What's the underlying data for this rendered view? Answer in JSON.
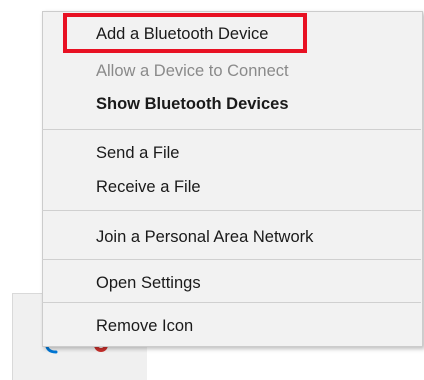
{
  "context_menu": {
    "items": [
      {
        "label": "Add a Bluetooth Device",
        "state": "enabled",
        "bold": false,
        "highlighted": true
      },
      {
        "label": "Allow a Device to Connect",
        "state": "disabled",
        "bold": false
      },
      {
        "label": "Show Bluetooth Devices",
        "state": "enabled",
        "bold": true
      },
      {
        "label": "Send a File",
        "state": "enabled",
        "bold": false
      },
      {
        "label": "Receive a File",
        "state": "enabled",
        "bold": false
      },
      {
        "label": "Join a Personal Area Network",
        "state": "enabled",
        "bold": false
      },
      {
        "label": "Open Settings",
        "state": "enabled",
        "bold": false
      },
      {
        "label": "Remove Icon",
        "state": "enabled",
        "bold": false
      }
    ]
  },
  "tray": {
    "icons": [
      "bluetooth-icon",
      "app-icon"
    ]
  },
  "colors": {
    "menu_background": "#f2f2f2",
    "highlight_border": "#e81123",
    "disabled_text": "#8a8a8a",
    "text": "#1a1a1a",
    "bluetooth_blue": "#0078d7"
  }
}
